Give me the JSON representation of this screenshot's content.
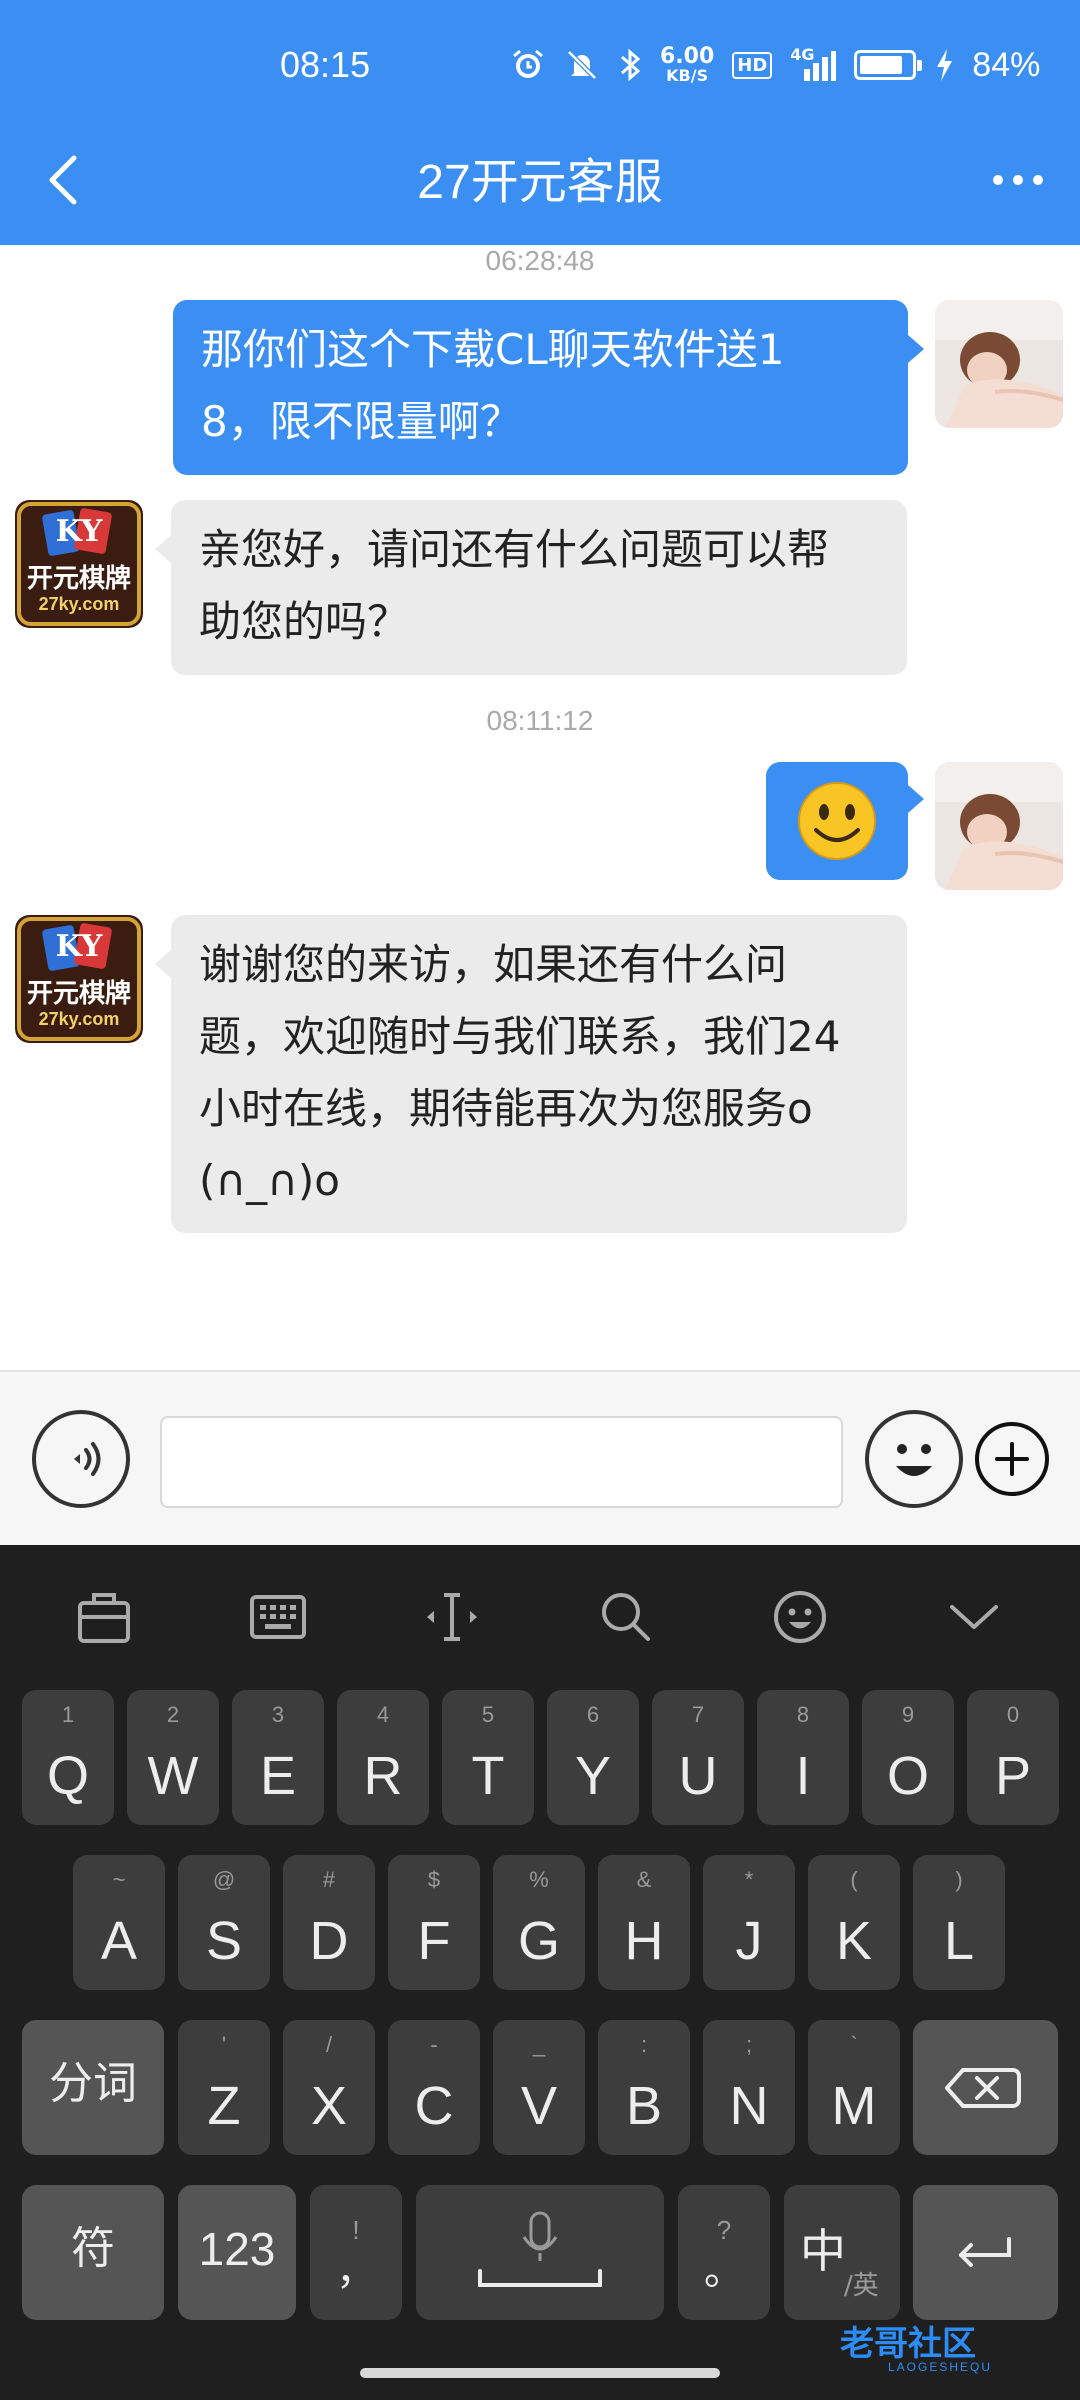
{
  "status_bar": {
    "time": "08:15",
    "network_speed_value": "6.00",
    "network_speed_unit": "KB/S",
    "hd": "HD",
    "signal_label": "4G",
    "battery": "84%",
    "battery_level": 0.84,
    "icons": [
      "alarm-icon",
      "mute-icon",
      "bluetooth-icon",
      "signal-icon",
      "battery-icon",
      "charging-icon"
    ]
  },
  "header": {
    "title": "27开元客服",
    "back_icon": "back-icon",
    "more_icon": "more-icon",
    "color": "#3b8ff3"
  },
  "messages": {
    "ts1": "06:28:48",
    "m1": {
      "line1": "那你们这个下载CL聊天软件送1",
      "line2": "8，限不限量啊？"
    },
    "m2": {
      "line1": "亲您好，请问还有什么问题可以帮",
      "line2": "助您的吗？"
    },
    "ts2": "08:11:12",
    "m3_emoji": "🙂",
    "m4": {
      "line1": "谢谢您的来访，如果还有什么问",
      "line2": "题，欢迎随时与我们联系，我们24",
      "line3": "小时在线，期待能再次为您服务o",
      "line4": "(∩_∩)o"
    },
    "agent_logo": {
      "top": "KY",
      "main": "开元棋牌",
      "site": "27ky.com"
    }
  },
  "input_bar": {
    "voice_icon": "voice-icon",
    "text_value": "",
    "emoji_icon": "emoji-icon",
    "plus_icon": "plus-icon"
  },
  "keyboard": {
    "toolbar": [
      "clipboard-icon",
      "keyboard-icon",
      "cursor-icon",
      "search-icon",
      "emoji-icon",
      "collapse-icon"
    ],
    "row1": [
      {
        "main": "Q",
        "hint": "1"
      },
      {
        "main": "W",
        "hint": "2"
      },
      {
        "main": "E",
        "hint": "3"
      },
      {
        "main": "R",
        "hint": "4"
      },
      {
        "main": "T",
        "hint": "5"
      },
      {
        "main": "Y",
        "hint": "6"
      },
      {
        "main": "U",
        "hint": "7"
      },
      {
        "main": "I",
        "hint": "8"
      },
      {
        "main": "O",
        "hint": "9"
      },
      {
        "main": "P",
        "hint": "0"
      }
    ],
    "row2": [
      {
        "main": "A",
        "hint": "~"
      },
      {
        "main": "S",
        "hint": "@"
      },
      {
        "main": "D",
        "hint": "#"
      },
      {
        "main": "F",
        "hint": "$"
      },
      {
        "main": "G",
        "hint": "%"
      },
      {
        "main": "H",
        "hint": "&"
      },
      {
        "main": "J",
        "hint": "*"
      },
      {
        "main": "K",
        "hint": "("
      },
      {
        "main": "L",
        "hint": ")"
      }
    ],
    "row3": [
      {
        "main": "Z",
        "hint": "'"
      },
      {
        "main": "X",
        "hint": "/"
      },
      {
        "main": "C",
        "hint": "-"
      },
      {
        "main": "V",
        "hint": "_"
      },
      {
        "main": "B",
        "hint": ":"
      },
      {
        "main": "N",
        "hint": ";"
      },
      {
        "main": "M",
        "hint": "`"
      }
    ],
    "fenci": "分词",
    "fu": "符",
    "num": "123",
    "comma_main": "，",
    "comma_hint": "!",
    "period_main": "。",
    "period_hint": "?",
    "zhong": "中",
    "ying": "/英",
    "backspace_icon": "backspace-icon",
    "enter_icon": "enter-icon",
    "mic_icon": "mic-icon"
  },
  "watermark": {
    "text": "老哥社区",
    "sub": "LAOGESHEQU"
  }
}
